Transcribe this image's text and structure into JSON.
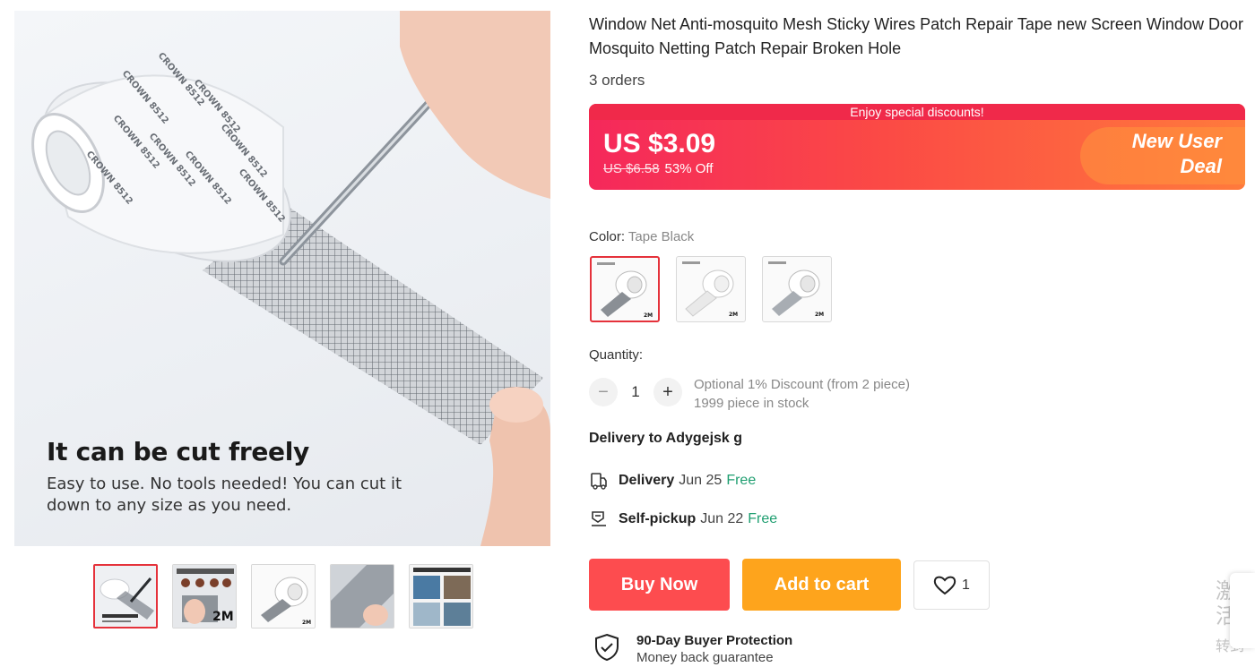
{
  "gallery": {
    "main_image": {
      "headline": "It can be cut freely",
      "subtext": "Easy to use. No tools needed! You can cut it down to any size as you need.",
      "tape_print": "CROWN"
    },
    "thumbnails": [
      {
        "id": "cut-freely",
        "selected": true
      },
      {
        "id": "window-door",
        "selected": false,
        "badge": "2M"
      },
      {
        "id": "tape-roll",
        "selected": false,
        "badge": "2M"
      },
      {
        "id": "mesh-closeup",
        "selected": false
      },
      {
        "id": "applications",
        "selected": false
      }
    ]
  },
  "product": {
    "title": "Window Net Anti-mosquito Mesh Sticky Wires Patch Repair Tape new Screen Window Door Mosquito Netting Patch Repair Broken Hole",
    "orders": "3 orders"
  },
  "price": {
    "banner_text": "Enjoy special discounts!",
    "current": "US $3.09",
    "original": "US $6.58",
    "discount": "53% Off",
    "deal_line1": "New User",
    "deal_line2": "Deal",
    "colors": {
      "banner_start": "#f5285b",
      "banner_end": "#ff7a3c"
    }
  },
  "color": {
    "label": "Color:",
    "selected": "Tape Black",
    "options": [
      {
        "name": "Tape Black",
        "selected": true,
        "badge": "2M"
      },
      {
        "name": "Tape White",
        "selected": false,
        "badge": "2M"
      },
      {
        "name": "Tape Grey",
        "selected": false,
        "badge": "2M"
      }
    ]
  },
  "quantity": {
    "label": "Quantity:",
    "value": "1",
    "minus": "−",
    "plus": "+",
    "discount_note": "Optional 1% Discount (from 2 piece)",
    "stock": "1999 piece in stock"
  },
  "shipping": {
    "deliver_to": "Delivery to Adygejsk g",
    "delivery": {
      "label": "Delivery",
      "date": "Jun 25",
      "cost": "Free"
    },
    "pickup": {
      "label": "Self-pickup",
      "date": "Jun 22",
      "cost": "Free"
    }
  },
  "actions": {
    "buy_now": "Buy Now",
    "add_to_cart": "Add to cart",
    "wishlist_count": "1",
    "colors": {
      "buy": "#fd4c4f",
      "cart": "#fea41c"
    }
  },
  "protection": {
    "title": "90-Day Buyer Protection",
    "subtitle": "Money back guarantee"
  },
  "overlay": {
    "watermark_line1": "激活",
    "watermark_line2": "转到"
  }
}
